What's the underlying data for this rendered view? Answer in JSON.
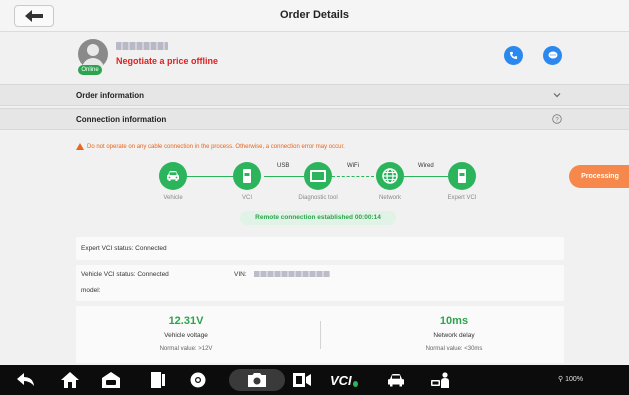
{
  "header": {
    "title": "Order Details",
    "back_icon": "arrow-left-icon"
  },
  "user": {
    "online_label": "Online",
    "negotiate_text": "Negotiate a price offline",
    "call_icon": "phone-icon",
    "chat_icon": "chat-bubble-icon"
  },
  "sections": {
    "order_info": "Order information",
    "connection_info": "Connection information"
  },
  "warning_text": "Do not operate on any cable connection in the process. Otherwise, a connection error may occur.",
  "connection": {
    "nodes": [
      {
        "label": "Vehicle",
        "icon": "car-icon"
      },
      {
        "label": "VCI",
        "icon": "vci-device-icon"
      },
      {
        "label": "Diagnostic tool",
        "icon": "tablet-icon"
      },
      {
        "label": "Network",
        "icon": "globe-icon"
      },
      {
        "label": "Expert VCI",
        "icon": "vci-device-icon"
      }
    ],
    "links": [
      "USB",
      "WiFi",
      "Wired"
    ],
    "remote_status": "Remote connection established 00:00:14"
  },
  "processing_label": "Processing",
  "expert_vci_status": "Expert VCI status:  Connected",
  "vehicle_vci_status": "Vehicle VCI status:  Connected",
  "vin_label": "VIN:",
  "model_label": "model:",
  "metrics": {
    "voltage": {
      "value": "12.31V",
      "name": "Vehicle voltage",
      "normal": "Normal value: >12V"
    },
    "delay": {
      "value": "10ms",
      "name": "Network delay",
      "normal": "Normal value: <30ms"
    }
  },
  "statusbar": {
    "text": "100%"
  },
  "colors": {
    "green": "#2bb45c",
    "orange": "#f5884a",
    "blue": "#2b88ef",
    "red": "#e02020"
  }
}
